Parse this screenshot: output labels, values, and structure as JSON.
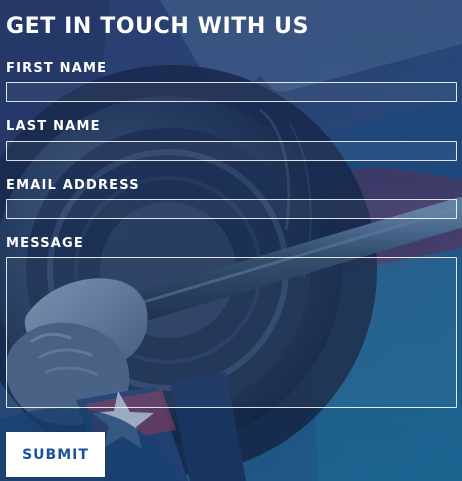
{
  "form": {
    "title": "GET IN TOUCH WITH US",
    "fields": {
      "first_name": {
        "label": "FIRST NAME",
        "value": "",
        "placeholder": ""
      },
      "last_name": {
        "label": "LAST NAME",
        "value": "",
        "placeholder": ""
      },
      "email_address": {
        "label": "EMAIL ADDRESS",
        "value": "",
        "placeholder": ""
      },
      "message": {
        "label": "MESSAGE",
        "value": "",
        "placeholder": ""
      }
    },
    "submit_label": "SUBMIT"
  },
  "colors": {
    "background_blue": "#233a6a",
    "submit_text": "#19549a",
    "text_white": "#ffffff"
  }
}
